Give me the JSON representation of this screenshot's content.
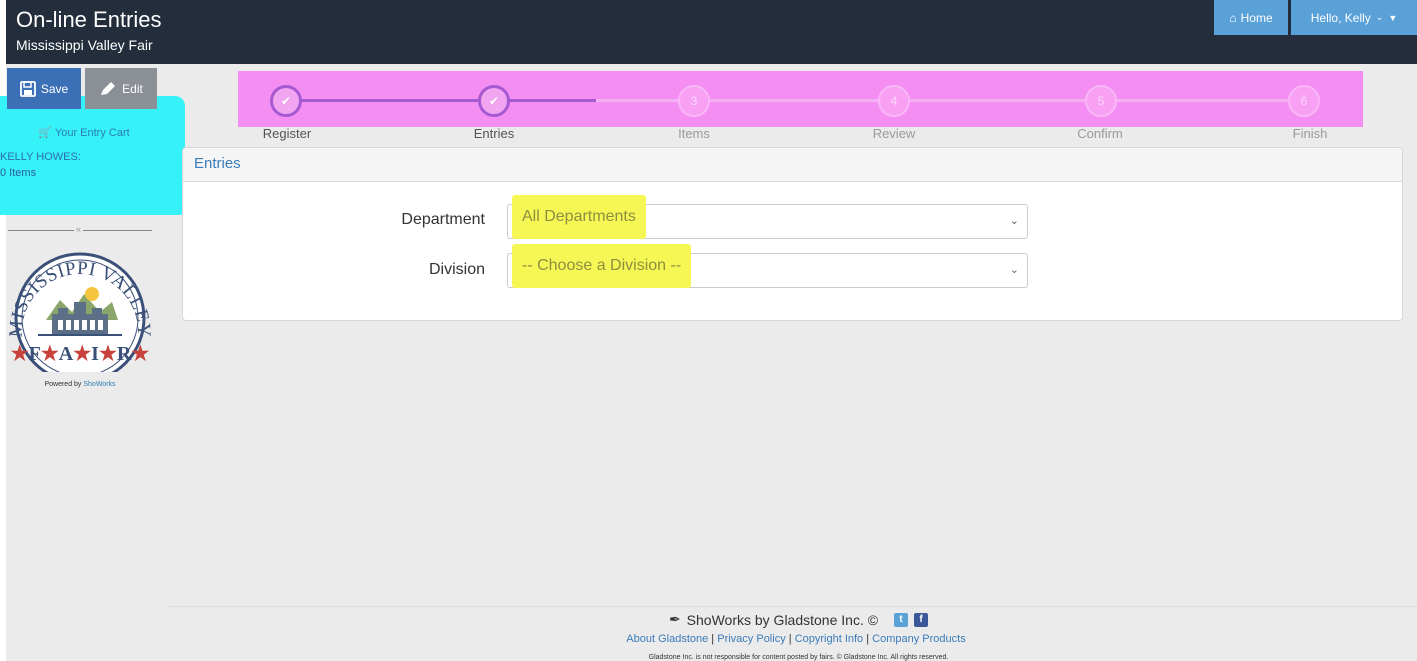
{
  "header": {
    "title": "On-line Entries",
    "subtitle": "Mississippi Valley Fair",
    "home_label": "Home",
    "user_label": "Hello, Kelly"
  },
  "sidebar": {
    "save_label": "Save",
    "edit_label": "Edit",
    "cart_title": "Your Entry Cart",
    "cart_name": "KELLY HOWES:",
    "cart_items": "0 Items",
    "powered_prefix": "Powered by",
    "powered_link": "ShoWorks",
    "logo": {
      "top_text": "MISSISSIPPI VALLEY",
      "bottom_text": "F·A·I·R"
    }
  },
  "steps": [
    {
      "label": "Register",
      "number": "1",
      "status": "done"
    },
    {
      "label": "Entries",
      "number": "2",
      "status": "done"
    },
    {
      "label": "Items",
      "number": "3",
      "status": "todo"
    },
    {
      "label": "Review",
      "number": "4",
      "status": "todo"
    },
    {
      "label": "Confirm",
      "number": "5",
      "status": "todo"
    },
    {
      "label": "Finish",
      "number": "6",
      "status": "todo"
    }
  ],
  "entries": {
    "heading": "Entries",
    "department_label": "Department",
    "department_value": "All Departments",
    "division_label": "Division",
    "division_value": "-- Choose a Division --"
  },
  "footer": {
    "brand": "ShoWorks by Gladstone Inc. ©",
    "links": [
      "About Gladstone",
      "Privacy Policy",
      "Copyright Info",
      "Company Products"
    ],
    "note": "Gladstone Inc. is not responsible for content posted by fairs. © Gladstone Inc. All rights reserved."
  },
  "colors": {
    "header_bg": "#232d3b",
    "accent_blue": "#5aa1d8",
    "highlight_magenta": "#f58ef2",
    "highlight_cyan": "#36f1f7",
    "highlight_yellow": "#f6f754"
  }
}
